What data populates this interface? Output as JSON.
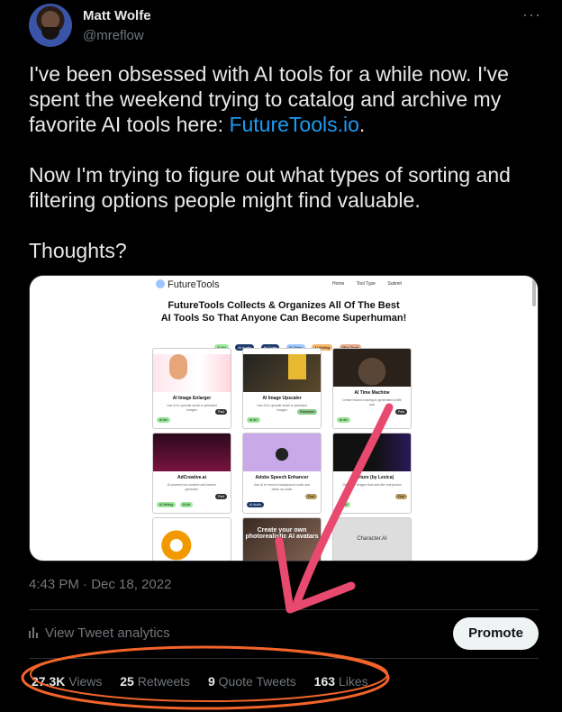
{
  "author": {
    "name": "Matt Wolfe",
    "handle": "@mreflow"
  },
  "more_icon": "ellipsis-icon",
  "tweet": {
    "line1_prefix": "I've  been obsessed with AI tools for a while now. I've spent the weekend trying to catalog and archive my favorite AI tools here: ",
    "link": "FutureTools.io",
    "line1_suffix": ".",
    "para2": "Now I'm trying to figure out what types of sorting and filtering options people might find valuable.",
    "para3": "Thoughts?"
  },
  "media": {
    "logo": "FutureTools",
    "nav": [
      "Home",
      "Tool Type",
      "Submit"
    ],
    "headline1": "FutureTools Collects & Organizes All Of The Best",
    "headline2": "AI Tools So That Anyone Can Become Superhuman!",
    "chips": [
      "AI Art",
      "AI Audio",
      "AI Code",
      "AI Video",
      "AI Writing",
      "Misc Tools"
    ],
    "cards": [
      {
        "title": "AI Image Enlarger",
        "desc": "Use AI to upscale small or pixelated images",
        "tag": "AI Art",
        "price": "Paid"
      },
      {
        "title": "AI Image Upscaler",
        "desc": "Use AI to upscale small or pixelated images",
        "tag": "AI Art",
        "price": "Freemium"
      },
      {
        "title": "AI Time Machine",
        "desc": "Create historic looking AI generated profile pics",
        "tag": "AI Art",
        "price": "Paid"
      },
      {
        "title": "AdCreative.ai",
        "desc": "AI powered ad creative and banner generator",
        "tag": "AI Writing",
        "tag2": "AI Art",
        "price": "Paid"
      },
      {
        "title": "Adobe Speech Enhancer",
        "desc": "Use AI to remove background noise and clean up audio",
        "tag": "AI Audio",
        "price": "Free"
      },
      {
        "title": "Aperture (by Lexica)",
        "desc": "Generate images that look like real photos",
        "tag": "AI Art",
        "price": "Free"
      },
      {
        "title": "",
        "desc": "",
        "tag": "",
        "price": ""
      },
      {
        "title": "",
        "desc": "",
        "overlay": "Create your own photorealistic AI avatars",
        "tag": "",
        "price": ""
      },
      {
        "title": "",
        "desc": "",
        "overlay": "Character.AI",
        "tag": "",
        "price": ""
      }
    ]
  },
  "timestamp": "4:43 PM · Dec 18, 2022",
  "analytics_label": "View Tweet analytics",
  "promote_label": "Promote",
  "stats": [
    {
      "value": "27.3K",
      "label": "Views"
    },
    {
      "value": "25",
      "label": "Retweets"
    },
    {
      "value": "9",
      "label": "Quote Tweets"
    },
    {
      "value": "163",
      "label": "Likes"
    }
  ],
  "colors": {
    "link": "#1d9bf0",
    "annotation": "#e84a6f",
    "circle": "#f2642a"
  }
}
